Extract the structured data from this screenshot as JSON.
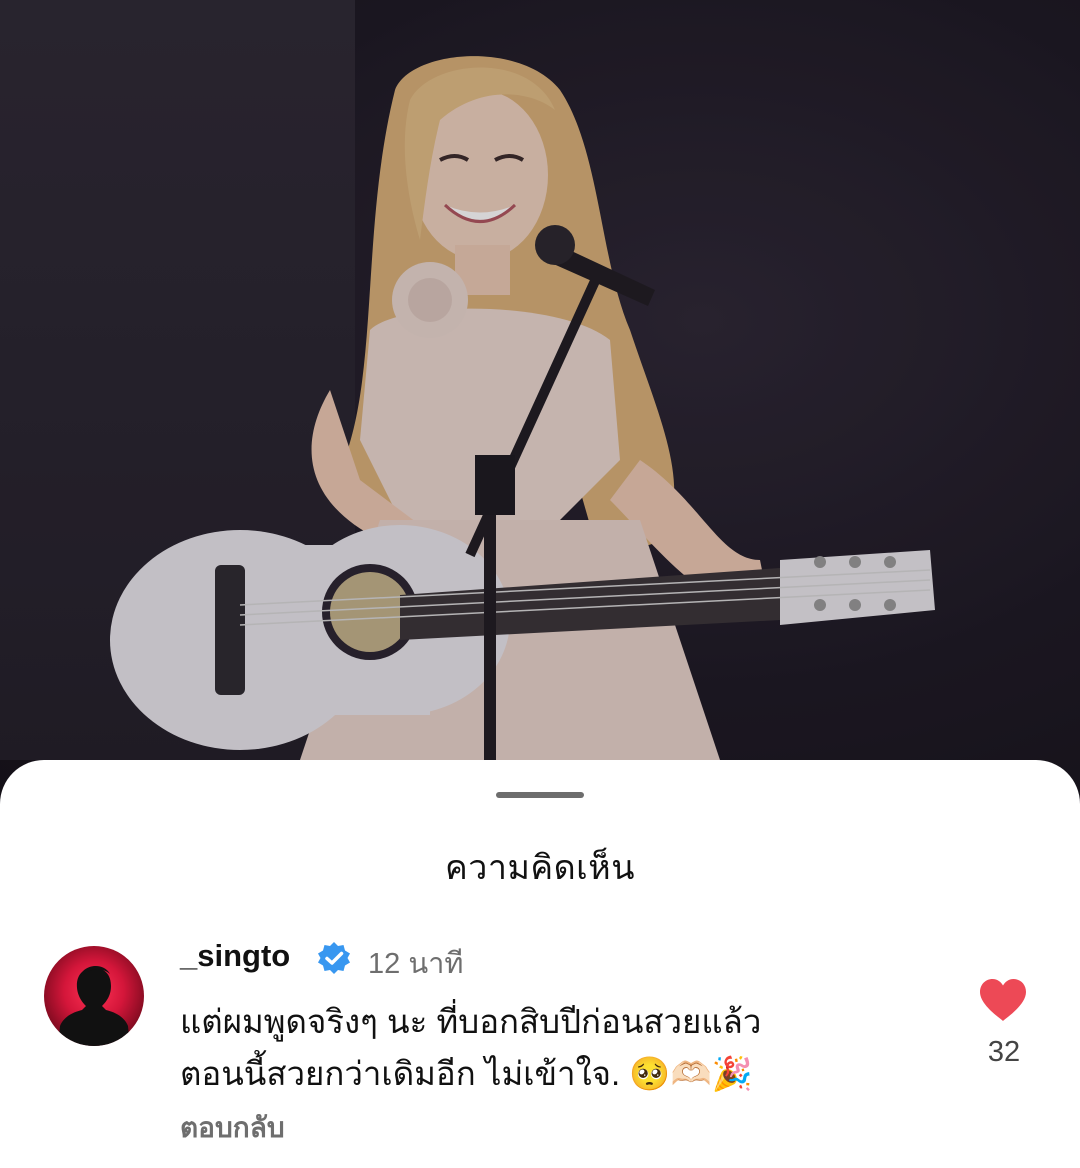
{
  "sheet": {
    "title": "ความคิดเห็น"
  },
  "comment": {
    "username": "_singto",
    "verified": true,
    "time": "12 นาที",
    "text_line1": "แต่ผมพูดจริงๆ นะ ที่บอกสิบปีก่อนสวยแล้ว",
    "text_line2": "ตอนนี้สวยกว่าเดิมอีก ไม่เข้าใจ. 🥺🫶🏻🎉",
    "reply_label": "ตอบกลับ",
    "like_count": "32",
    "liked": true
  },
  "colors": {
    "like": "#ed4956",
    "verified": "#3897f0",
    "avatar": "#d4163a"
  },
  "icons": {
    "verified": "verified-badge-icon",
    "like": "heart-icon"
  }
}
